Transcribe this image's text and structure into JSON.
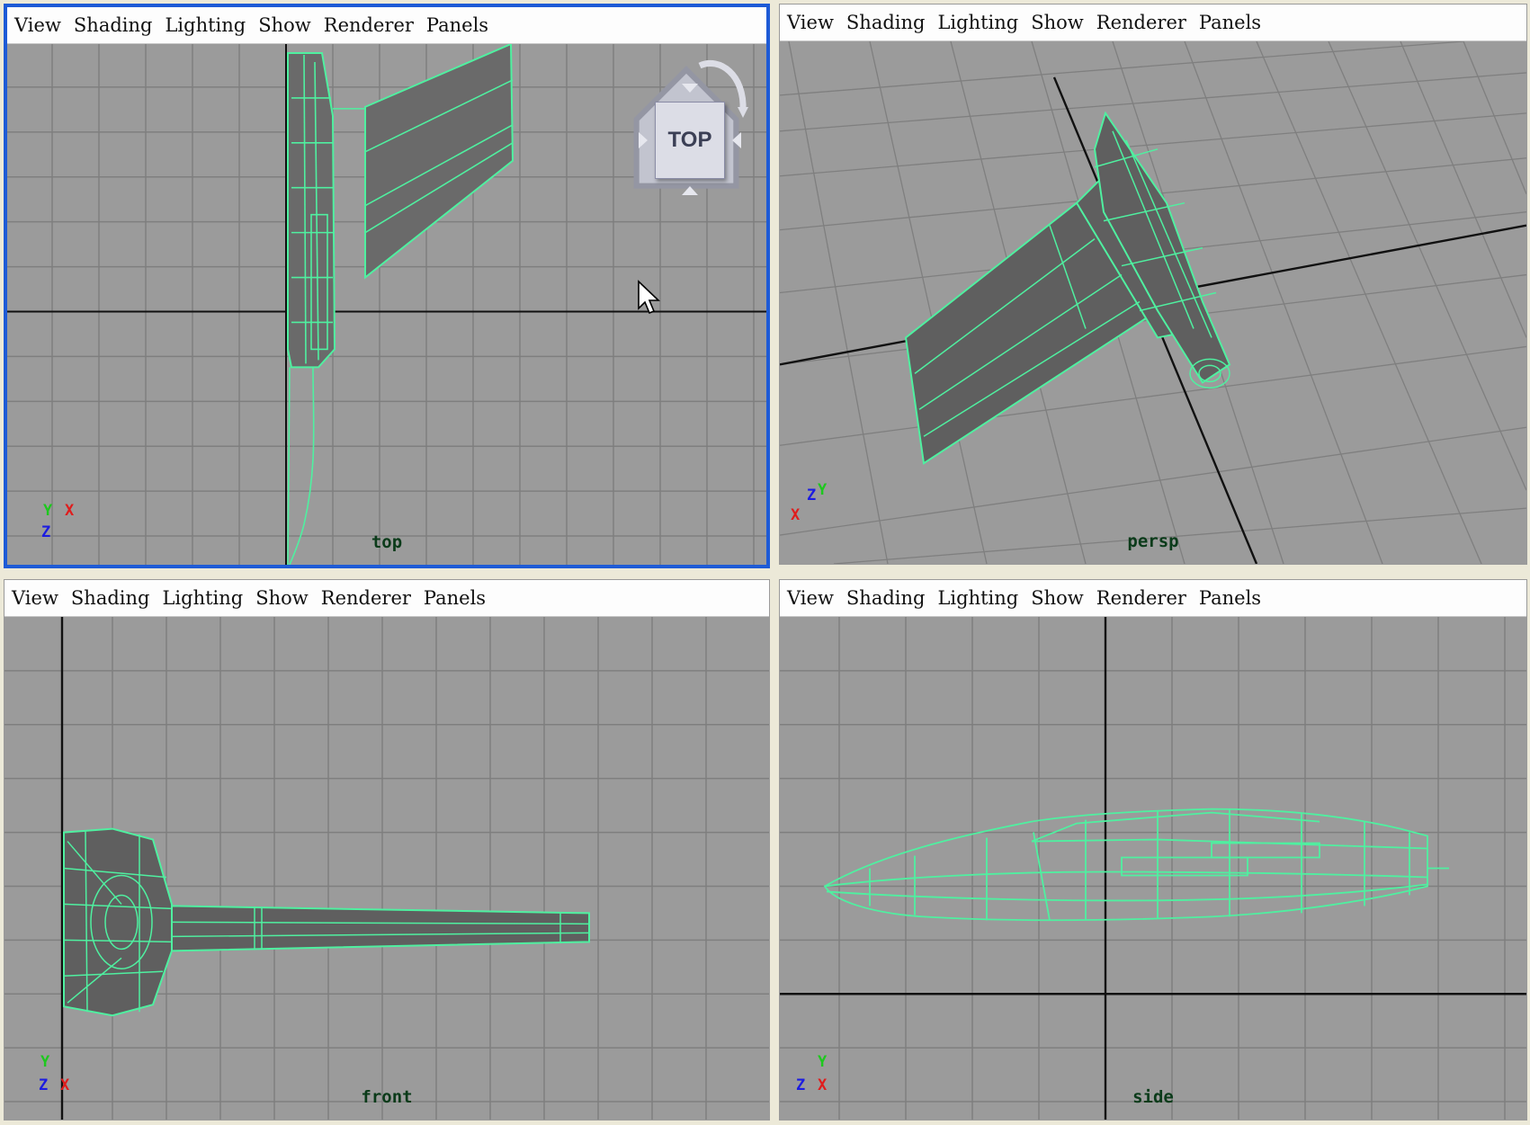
{
  "menu": [
    "View",
    "Shading",
    "Lighting",
    "Show",
    "Renderer",
    "Panels"
  ],
  "panels": {
    "top": {
      "camera": "top",
      "axes": [
        "Y",
        "X",
        "Z"
      ],
      "active": true
    },
    "persp": {
      "camera": "persp",
      "axes": [
        "Z",
        "Y",
        "X"
      ]
    },
    "front": {
      "camera": "front",
      "axes": [
        "Y",
        "Z",
        "X"
      ]
    },
    "side": {
      "camera": "side",
      "axes": [
        "Y",
        "Z",
        "X"
      ]
    }
  },
  "viewcube": {
    "face": "TOP"
  },
  "colors": {
    "grid_bg": "#9b9b9b",
    "grid_line": "#7c7c7c",
    "wireframe": "#4ff0a0",
    "active_border": "#1e5bd6"
  },
  "icons": [
    "home-icon",
    "rotate-arrow-icon",
    "mouse-cursor-icon"
  ]
}
